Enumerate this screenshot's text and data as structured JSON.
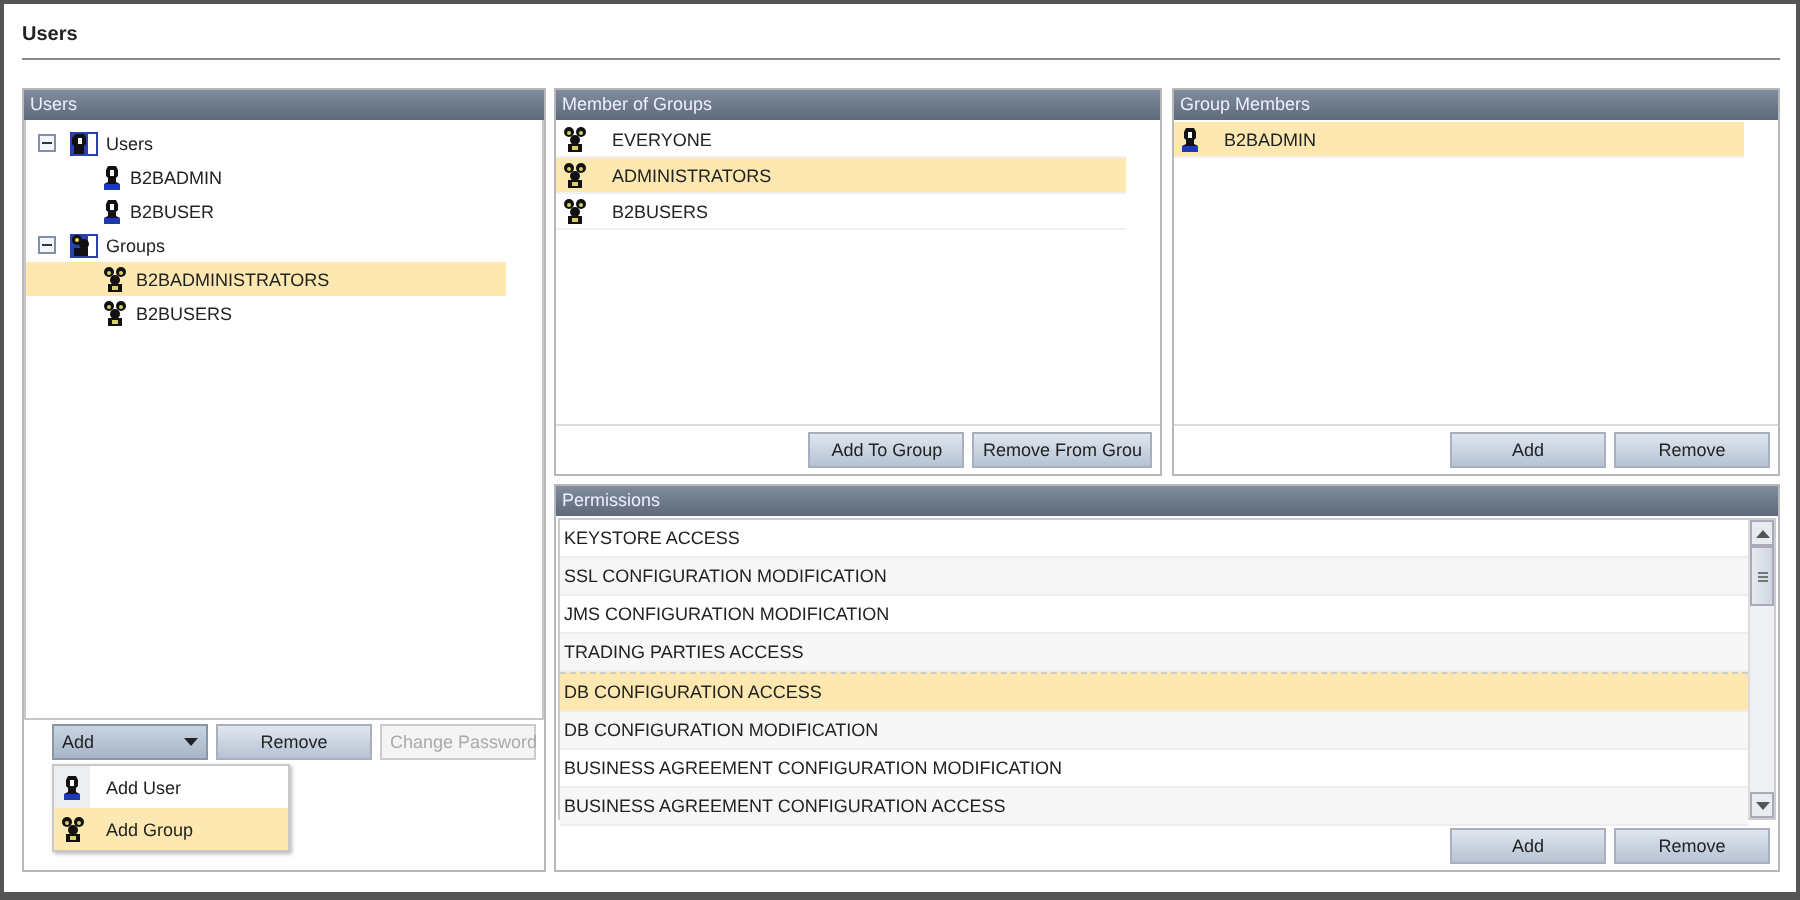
{
  "page_title": "Users",
  "users_panel": {
    "title": "Users",
    "tree": [
      {
        "label": "Users",
        "kind": "user-folder",
        "expanded": true,
        "selected": false,
        "children": [
          {
            "label": "B2BADMIN",
            "kind": "user",
            "selected": false
          },
          {
            "label": "B2BUSER",
            "kind": "user",
            "selected": false
          }
        ]
      },
      {
        "label": "Groups",
        "kind": "group-folder",
        "expanded": true,
        "selected": false,
        "children": [
          {
            "label": "B2BADMINISTRATORS",
            "kind": "group",
            "selected": true
          },
          {
            "label": "B2BUSERS",
            "kind": "group",
            "selected": false
          }
        ]
      }
    ],
    "add_dropdown": {
      "label": "Add",
      "expanded": true,
      "items": [
        {
          "label": "Add User",
          "kind": "user",
          "selected": false
        },
        {
          "label": "Add Group",
          "kind": "group",
          "selected": true
        }
      ]
    },
    "buttons": [
      {
        "label": "Remove",
        "disabled": false
      },
      {
        "label": "Change Password",
        "disabled": true
      }
    ]
  },
  "member_of_groups": {
    "title": "Member of Groups",
    "items": [
      {
        "label": "EVERYONE",
        "kind": "group",
        "selected": false
      },
      {
        "label": "ADMINISTRATORS",
        "kind": "group",
        "selected": true
      },
      {
        "label": "B2BUSERS",
        "kind": "group",
        "selected": false
      }
    ],
    "buttons": [
      {
        "label": "Add To Group",
        "disabled": false
      },
      {
        "label": "Remove From Grou",
        "disabled": false
      }
    ]
  },
  "group_members": {
    "title": "Group Members",
    "items": [
      {
        "label": "B2BADMIN",
        "kind": "user",
        "selected": true
      }
    ],
    "buttons": [
      {
        "label": "Add",
        "disabled": false
      },
      {
        "label": "Remove",
        "disabled": false
      }
    ]
  },
  "permissions": {
    "title": "Permissions",
    "items": [
      {
        "label": "KEYSTORE ACCESS",
        "selected": false
      },
      {
        "label": "SSL CONFIGURATION MODIFICATION",
        "selected": false
      },
      {
        "label": "JMS CONFIGURATION MODIFICATION",
        "selected": false
      },
      {
        "label": "TRADING PARTIES ACCESS",
        "selected": false
      },
      {
        "label": "DB CONFIGURATION ACCESS",
        "selected": true
      },
      {
        "label": "DB CONFIGURATION MODIFICATION",
        "selected": false
      },
      {
        "label": "BUSINESS AGREEMENT CONFIGURATION MODIFICATION",
        "selected": false
      },
      {
        "label": "BUSINESS AGREEMENT CONFIGURATION ACCESS",
        "selected": false
      }
    ],
    "buttons": [
      {
        "label": "Add",
        "disabled": false
      },
      {
        "label": "Remove",
        "disabled": false
      }
    ]
  }
}
